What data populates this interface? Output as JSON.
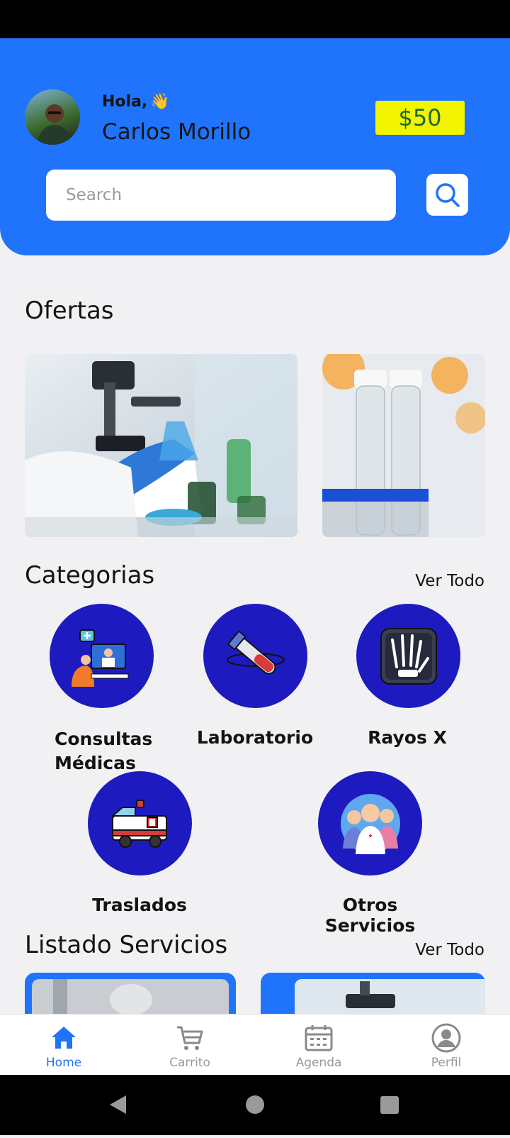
{
  "header": {
    "greeting": "Hola,",
    "greeting_emoji": "👋",
    "user_name": "Carlos Morillo",
    "balance": "$50"
  },
  "search": {
    "placeholder": "Search"
  },
  "offers": {
    "title": "Ofertas"
  },
  "categories": {
    "title": "Categorias",
    "see_all": "Ver Todo",
    "items": [
      {
        "label": "Consultas Médicas",
        "icon": "doctor-consultation-icon"
      },
      {
        "label": "Laboratorio",
        "icon": "test-tube-icon"
      },
      {
        "label": "Rayos X",
        "icon": "x-ray-hand-icon"
      },
      {
        "label": "Traslados",
        "icon": "ambulance-icon"
      },
      {
        "label": "Otros Servicios",
        "icon": "medical-staff-icon"
      }
    ]
  },
  "services": {
    "title": "Listado Servicios",
    "see_all": "Ver Todo"
  },
  "bottom_nav": {
    "items": [
      {
        "label": "Home",
        "icon": "home-icon",
        "active": true
      },
      {
        "label": "Carrito",
        "icon": "cart-icon",
        "active": false
      },
      {
        "label": "Agenda",
        "icon": "calendar-icon",
        "active": false
      },
      {
        "label": "Perfil",
        "icon": "profile-icon",
        "active": false
      }
    ]
  },
  "colors": {
    "brand_blue": "#1f74fb",
    "category_circle": "#1d1bbf",
    "balance_bg": "#f2f400",
    "balance_text": "#1b6a2a"
  }
}
